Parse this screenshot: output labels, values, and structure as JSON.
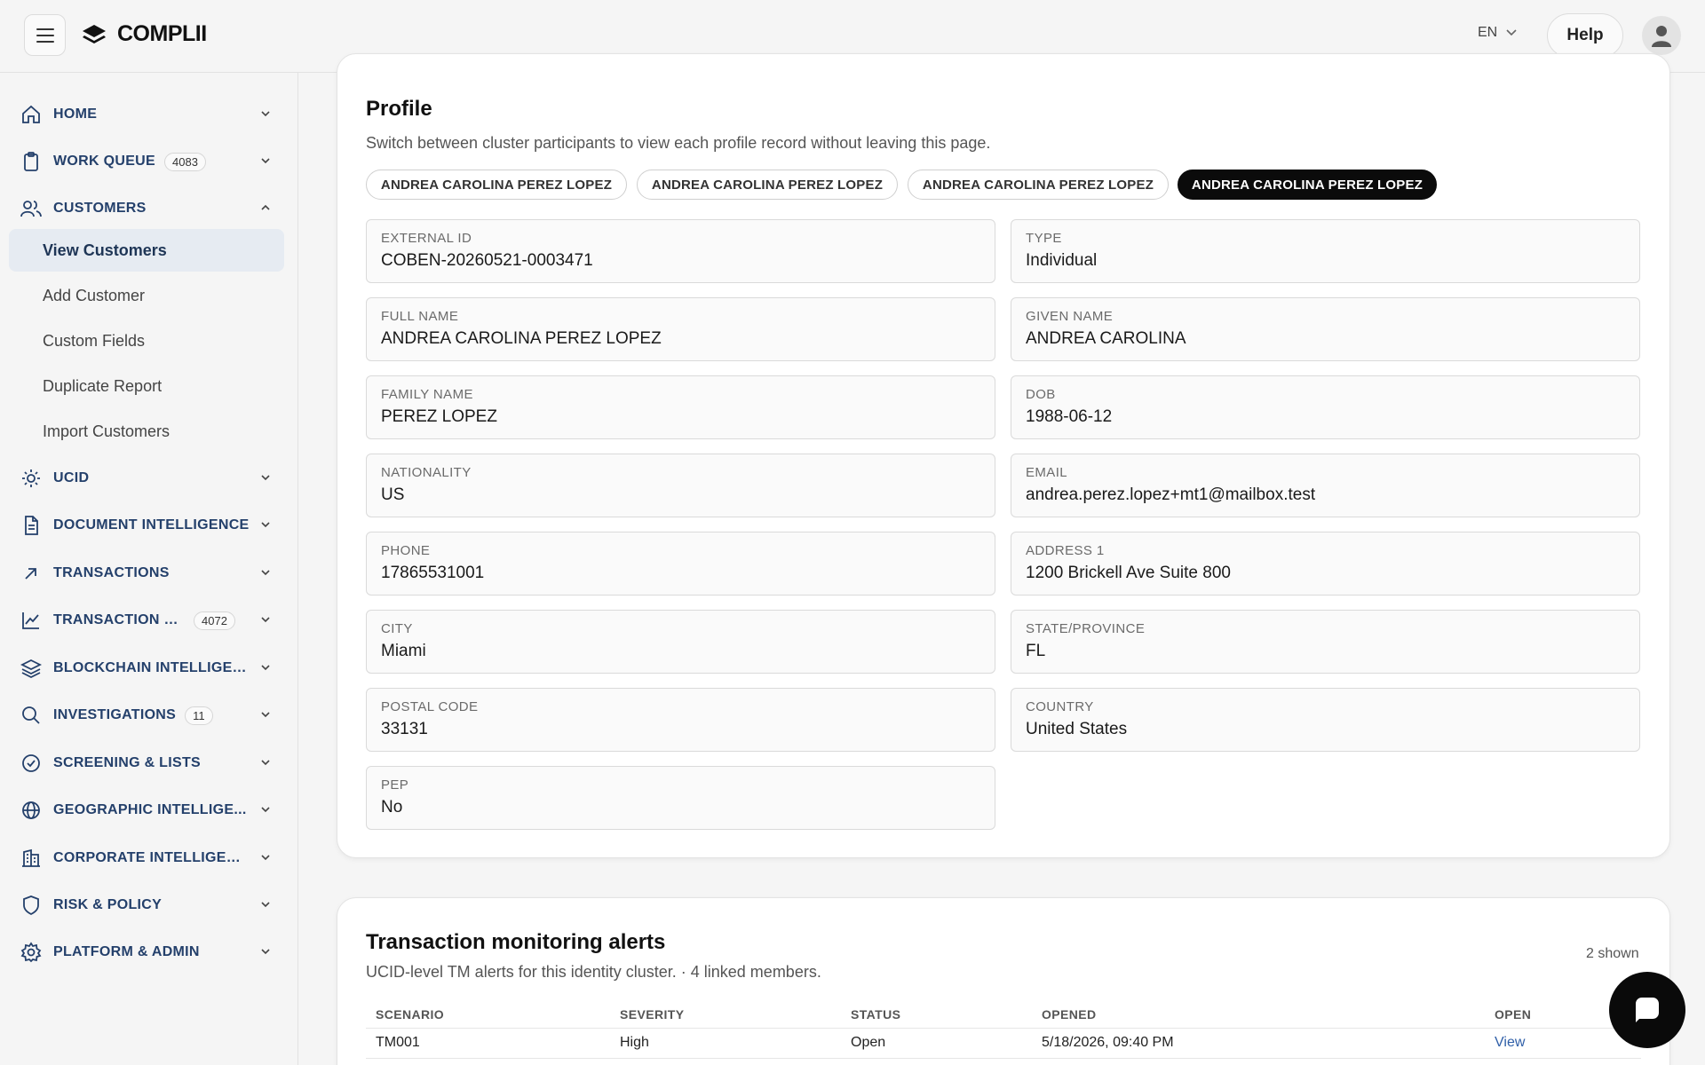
{
  "header": {
    "brand": "COMPLII",
    "language": "EN",
    "help_label": "Help"
  },
  "sidebar": {
    "items": [
      {
        "label": "HOME",
        "icon": "home-icon"
      },
      {
        "label": "WORK QUEUE",
        "icon": "clipboard-icon",
        "badge": "4083"
      },
      {
        "label": "CUSTOMERS",
        "icon": "users-icon"
      },
      {
        "label": "UCID",
        "icon": "sun-icon"
      },
      {
        "label": "DOCUMENT INTELLIGENCE",
        "icon": "document-icon"
      },
      {
        "label": "TRANSACTIONS",
        "icon": "arrow-up-right-icon"
      },
      {
        "label": "TRANSACTION M...",
        "icon": "line-chart-icon",
        "badge": "4072"
      },
      {
        "label": "BLOCKCHAIN INTELLIGEN...",
        "icon": "layers-icon"
      },
      {
        "label": "INVESTIGATIONS",
        "icon": "search-icon",
        "badge": "11"
      },
      {
        "label": "SCREENING & LISTS",
        "icon": "check-circle-icon"
      },
      {
        "label": "GEOGRAPHIC INTELLIGE...",
        "icon": "globe-icon"
      },
      {
        "label": "CORPORATE INTELLIGEN...",
        "icon": "building-icon"
      },
      {
        "label": "RISK & POLICY",
        "icon": "shield-icon"
      },
      {
        "label": "PLATFORM & ADMIN",
        "icon": "gear-icon"
      }
    ],
    "customers_sub": [
      {
        "label": "View Customers"
      },
      {
        "label": "Add Customer"
      },
      {
        "label": "Custom Fields"
      },
      {
        "label": "Duplicate Report"
      },
      {
        "label": "Import Customers"
      }
    ]
  },
  "profile": {
    "title": "Profile",
    "subtitle": "Switch between cluster participants to view each profile record without leaving this page.",
    "participants": [
      "ANDREA CAROLINA PEREZ LOPEZ",
      "ANDREA CAROLINA PEREZ LOPEZ",
      "ANDREA CAROLINA PEREZ LOPEZ",
      "ANDREA CAROLINA PEREZ LOPEZ"
    ],
    "fields": [
      {
        "label": "EXTERNAL ID",
        "value": "COBEN-20260521-0003471"
      },
      {
        "label": "TYPE",
        "value": "Individual"
      },
      {
        "label": "FULL NAME",
        "value": "ANDREA CAROLINA PEREZ LOPEZ"
      },
      {
        "label": "GIVEN NAME",
        "value": "ANDREA CAROLINA"
      },
      {
        "label": "FAMILY NAME",
        "value": "PEREZ LOPEZ"
      },
      {
        "label": "DOB",
        "value": "1988-06-12"
      },
      {
        "label": "NATIONALITY",
        "value": "US"
      },
      {
        "label": "EMAIL",
        "value": "andrea.perez.lopez+mt1@mailbox.test"
      },
      {
        "label": "PHONE",
        "value": "17865531001"
      },
      {
        "label": "ADDRESS 1",
        "value": "1200 Brickell Ave Suite 800"
      },
      {
        "label": "CITY",
        "value": "Miami"
      },
      {
        "label": "STATE/PROVINCE",
        "value": "FL"
      },
      {
        "label": "POSTAL CODE",
        "value": "33131"
      },
      {
        "label": "COUNTRY",
        "value": "United States"
      },
      {
        "label": "PEP",
        "value": "No"
      }
    ]
  },
  "alerts": {
    "title": "Transaction monitoring alerts",
    "subtitle": "UCID-level TM alerts for this identity cluster. · 4 linked members.",
    "shown": "2 shown",
    "columns": [
      "SCENARIO",
      "SEVERITY",
      "STATUS",
      "OPENED",
      "OPEN"
    ],
    "rows": [
      {
        "scenario": "TM001",
        "severity": "High",
        "status": "Open",
        "opened": "5/18/2026, 09:40 PM",
        "open": "View"
      }
    ]
  },
  "colors": {
    "nav_text": "#24406b",
    "link": "#2f5fa8",
    "active_chip": "#0b0b0b"
  }
}
